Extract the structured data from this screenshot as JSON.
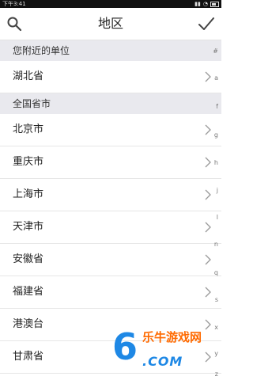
{
  "status_bar": {
    "time": "下午3:41"
  },
  "header": {
    "title": "地区",
    "search_icon": "search-icon",
    "confirm_icon": "check-icon"
  },
  "sections": {
    "nearby": "您附近的单位",
    "national": "全国省市"
  },
  "nearby_items": [
    {
      "label": "湖北省"
    }
  ],
  "province_items": [
    {
      "label": "北京市"
    },
    {
      "label": "重庆市"
    },
    {
      "label": "上海市"
    },
    {
      "label": "天津市"
    },
    {
      "label": "安徽省"
    },
    {
      "label": "福建省"
    },
    {
      "label": "港澳台"
    },
    {
      "label": "甘肃省"
    }
  ],
  "index_letters": [
    "#",
    "a",
    "f",
    "g",
    "h",
    "j",
    "l",
    "n",
    "q",
    "s",
    "x",
    "y",
    "z"
  ],
  "watermark": {
    "big": "6",
    "brand": "乐牛游戏网",
    "domain": ".COM"
  }
}
